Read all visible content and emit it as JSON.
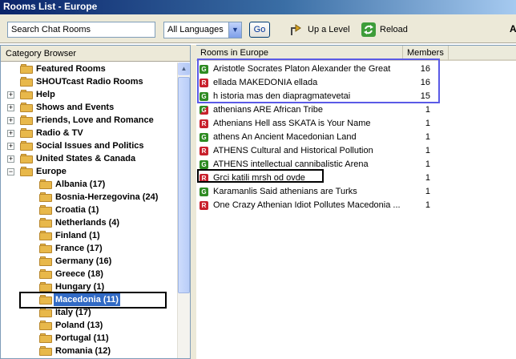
{
  "window": {
    "title": "Rooms List - Europe"
  },
  "toolbar": {
    "search_value": "Search Chat Rooms",
    "language_selected": "All Languages",
    "go_label": "Go",
    "up_level_label": "Up a Level",
    "reload_label": "Reload",
    "edge_text": "A"
  },
  "category_browser": {
    "header": "Category Browser",
    "items": [
      {
        "label": "Featured Rooms",
        "level": 0,
        "expander": ""
      },
      {
        "label": "SHOUTcast Radio Rooms",
        "level": 0,
        "expander": ""
      },
      {
        "label": "Help",
        "level": 0,
        "expander": "+"
      },
      {
        "label": "Shows and Events",
        "level": 0,
        "expander": "+"
      },
      {
        "label": "Friends, Love and Romance",
        "level": 0,
        "expander": "+"
      },
      {
        "label": "Radio & TV",
        "level": 0,
        "expander": "+"
      },
      {
        "label": "Social Issues and Politics",
        "level": 0,
        "expander": "+"
      },
      {
        "label": "United States & Canada",
        "level": 0,
        "expander": "+"
      },
      {
        "label": "Europe",
        "level": 0,
        "expander": "-"
      },
      {
        "label": "Albania (17)",
        "level": 1
      },
      {
        "label": "Bosnia-Herzegovina (24)",
        "level": 1
      },
      {
        "label": "Croatia (1)",
        "level": 1
      },
      {
        "label": "Netherlands (4)",
        "level": 1
      },
      {
        "label": "Finland (1)",
        "level": 1
      },
      {
        "label": "France (17)",
        "level": 1
      },
      {
        "label": "Germany (16)",
        "level": 1
      },
      {
        "label": "Greece (18)",
        "level": 1
      },
      {
        "label": "Hungary (1)",
        "level": 1
      },
      {
        "label": "Macedonia (11)",
        "level": 1,
        "selected": true
      },
      {
        "label": "Italy (17)",
        "level": 1
      },
      {
        "label": "Poland (13)",
        "level": 1
      },
      {
        "label": "Portugal (11)",
        "level": 1
      },
      {
        "label": "Romania (12)",
        "level": 1
      }
    ]
  },
  "rooms": {
    "columns": {
      "name": "Rooms in Europe",
      "members": "Members"
    },
    "rows": [
      {
        "badge": "G",
        "name": "Aristotle Socrates Platon Alexander the Great",
        "members": "16"
      },
      {
        "badge": "R",
        "name": "ellada MAKEDONIA ellada",
        "members": "16"
      },
      {
        "badge": "G",
        "name": "h istoria mas den diapragmatevetai",
        "members": "15"
      },
      {
        "badge": "GR",
        "name": "athenians ARE African Tribe",
        "members": "1"
      },
      {
        "badge": "R",
        "name": "Athenians Hell ass SKATA is Your Name",
        "members": "1"
      },
      {
        "badge": "G",
        "name": "athens An Ancient Macedonian Land",
        "members": "1"
      },
      {
        "badge": "R",
        "name": "ATHENS Cultural and Historical Pollution",
        "members": "1"
      },
      {
        "badge": "G",
        "name": "ATHENS intellectual cannibalistic Arena",
        "members": "1"
      },
      {
        "badge": "R",
        "name": "Grci katili mrsh od ovde",
        "members": "1"
      },
      {
        "badge": "G",
        "name": "Karamanlis Said athenians are Turks",
        "members": "1"
      },
      {
        "badge": "R",
        "name": "One Crazy Athenian Idiot Pollutes Macedonia ...",
        "members": "1"
      }
    ]
  },
  "colors": {
    "selection": "#316ac5",
    "highlight_blue": "#5a5ae6",
    "highlight_black": "#000000",
    "badge_green": "#2e8b22",
    "badge_red": "#c8202c"
  }
}
